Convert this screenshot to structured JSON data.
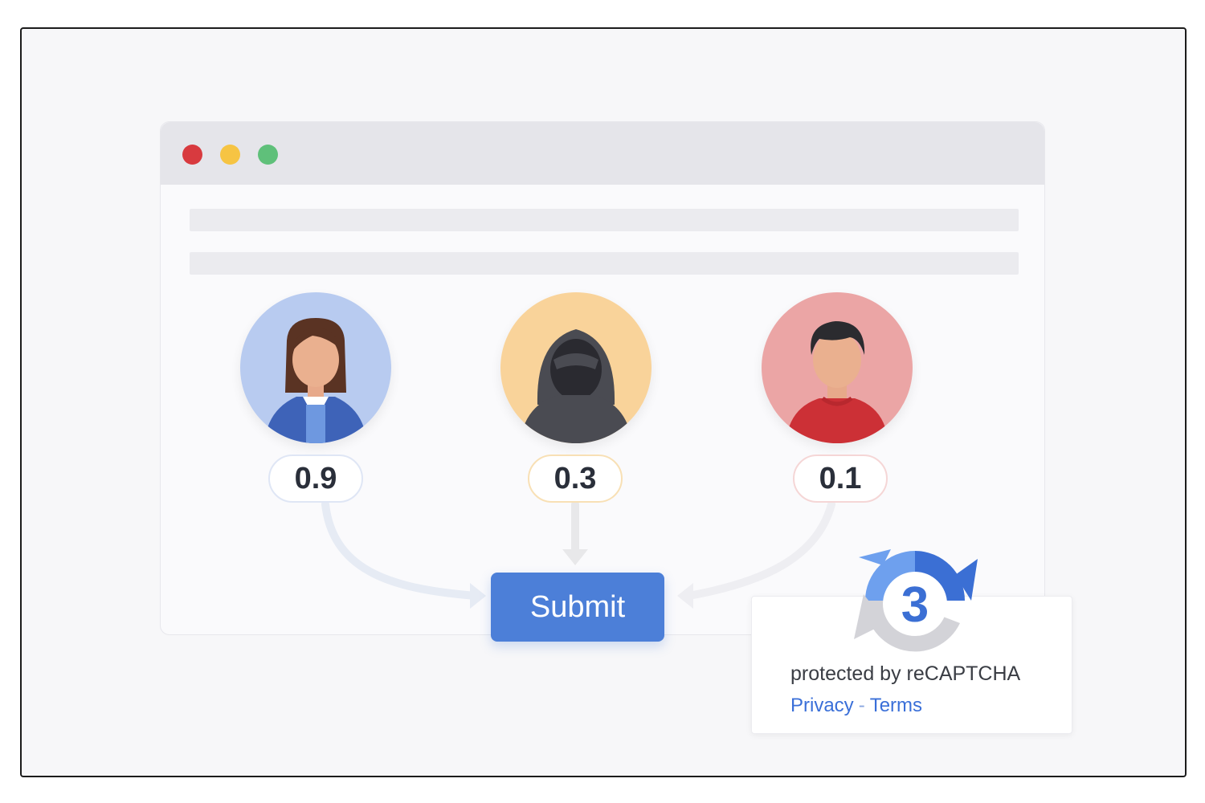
{
  "scores": [
    "0.9",
    "0.3",
    "0.1"
  ],
  "submit_label": "Submit",
  "badge": {
    "text": "protected by reCAPTCHA",
    "privacy_label": "Privacy",
    "separator": "-",
    "terms_label": "Terms",
    "logo_number": "3"
  },
  "colors": {
    "accent": "#4c7fd8",
    "avatar_human": "#b8cbf0",
    "avatar_hooded": "#f9d39a",
    "avatar_red": "#eba5a5",
    "link": "#3a6fd8"
  }
}
